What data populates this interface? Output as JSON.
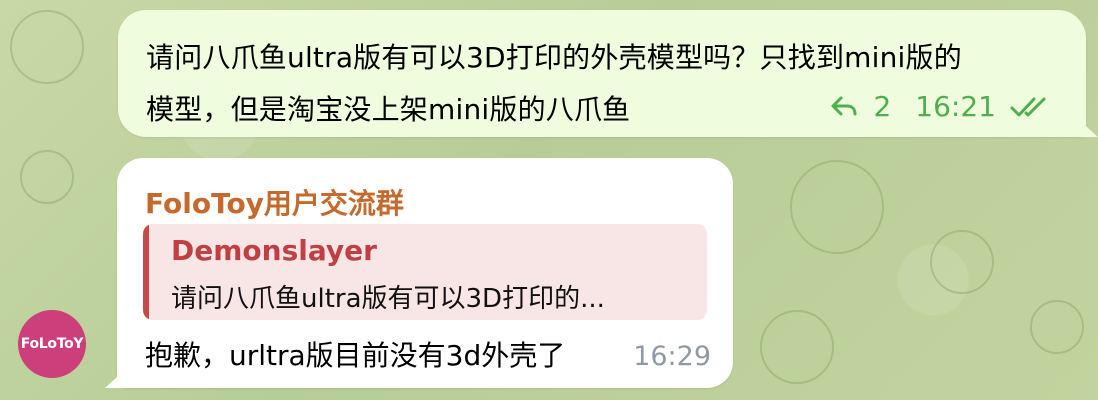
{
  "outgoing": {
    "line1": "请问八爪鱼ultra版有可以3D打印的外壳模型吗？只找到mini版的",
    "line2": "模型，但是淘宝没上架mini版的八爪鱼",
    "reply_count": "2",
    "time": "16:21"
  },
  "incoming": {
    "sender": "FoloToy用户交流群",
    "reply": {
      "author": "Demonslayer",
      "text": "请问八爪鱼ultra版有可以3D打印的..."
    },
    "text": "抱歉，urltra版目前没有3d外壳了",
    "time": "16:29"
  },
  "avatar": {
    "label": "FoLoToY",
    "color": "#cc3f7a"
  },
  "icons": {
    "reply_icon": "reply-arrow-icon",
    "read_icon": "double-check-icon"
  }
}
